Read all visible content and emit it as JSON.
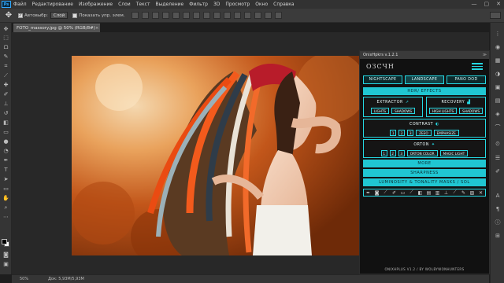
{
  "app": {
    "logo": "Ps",
    "menu": [
      "Файл",
      "Редактирование",
      "Изображение",
      "Слои",
      "Текст",
      "Выделение",
      "Фильтр",
      "3D",
      "Просмотр",
      "Окно",
      "Справка"
    ],
    "window_controls": [
      "—",
      "▢",
      "✕"
    ]
  },
  "options": {
    "tool_icon": "move-tool-icon",
    "autoselect_label": "Автовыбр:",
    "autoselect_value": "Слой",
    "show_transform_label": "Показать упр. элем."
  },
  "document": {
    "tab_title": "FOTO_massory.jpg @ 50% (RGB/8#)",
    "close": "×"
  },
  "status": {
    "zoom": "50%",
    "doc_size": "Док: 5,93М/5,93М"
  },
  "panel": {
    "header": "OnixHpkrs v.1.2.1",
    "header_ctrl": "≫",
    "brand": "ОЗСЧН",
    "tabs": [
      "NIGHTSCAPE",
      "LANDSCAPE",
      "PANO DOD"
    ],
    "bars": {
      "hdr": "HDR/ EFFECTS",
      "more": "MORE",
      "sharpness": "SHARPNESS",
      "luminosity": "LUMINOSITY & TONALITY MASKS / SOL"
    },
    "extractor": {
      "title": "EXTRACTOR",
      "buttons": [
        "LIGHTS",
        "SHADOWS"
      ]
    },
    "recovery": {
      "title": "RECOVERY",
      "buttons": [
        "HIGH LIGHTS",
        "SHADOWS"
      ]
    },
    "contrast": {
      "title": "CONTRAST",
      "nums": [
        "1",
        "2",
        "3"
      ],
      "buttons": [
        "ZEEO",
        "EMPHASIZE"
      ]
    },
    "orton": {
      "title": "ORTON",
      "nums": [
        "1",
        "2",
        "3"
      ],
      "buttons": [
        "ORTON COLOR",
        "MAGIC LIGHT"
      ]
    },
    "credit": "ONIXHPLUS V1.2 / BY WOLBYWONHUNTERS",
    "tool_icons": [
      "pen-icon",
      "mask-icon",
      "brush-icon",
      "brush-icon",
      "rectangle-icon",
      "brush-icon",
      "eraser-icon",
      "layers-icon",
      "gradient-icon",
      "stamp-icon",
      "eyedropper-icon",
      "eyedropper-icon",
      "stripe-icon",
      "close-icon"
    ]
  },
  "colors": {
    "accent": "#25d8e3",
    "panel_bg": "#111111",
    "ui_dark": "#353535",
    "canvas_bg": "#282828"
  }
}
